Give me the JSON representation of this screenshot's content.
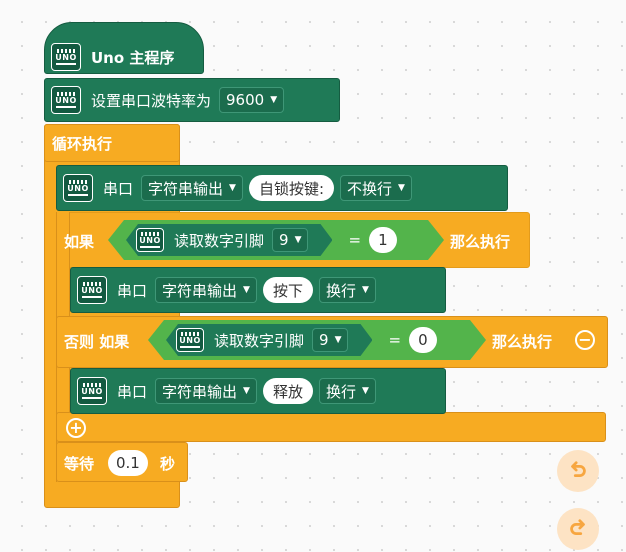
{
  "blocks": {
    "main_hat": {
      "label": "Uno 主程序",
      "icon_text": "UNO"
    },
    "serial_setup": {
      "label": "设置串口波特率为",
      "baud": "9600"
    },
    "loop": {
      "label": "循环执行"
    },
    "print1": {
      "prefix": "串口",
      "mode": "字符串输出",
      "text": "自锁按键:",
      "newline": "不换行"
    },
    "if1": {
      "label": "如果",
      "read_label": "读取数字引脚",
      "pin": "9",
      "op": "=",
      "value": "1",
      "then": "那么执行"
    },
    "print2": {
      "prefix": "串口",
      "mode": "字符串输出",
      "text": "按下",
      "newline": "换行"
    },
    "elseif": {
      "label": "否则 如果",
      "read_label": "读取数字引脚",
      "pin": "9",
      "op": "=",
      "value": "0",
      "then": "那么执行"
    },
    "print3": {
      "prefix": "串口",
      "mode": "字符串输出",
      "text": "释放",
      "newline": "换行"
    },
    "wait": {
      "label": "等待",
      "value": "0.1",
      "unit": "秒"
    }
  },
  "icons": {
    "board": "uno-board-icon",
    "dropdown": "dropdown-arrow-icon",
    "add": "plus-circle-icon",
    "remove": "minus-circle-icon",
    "undo": "undo-icon",
    "redo": "redo-icon"
  },
  "colors": {
    "orange": "#f7ab22",
    "green_dark": "#1f7a57",
    "green_light": "#53b44b",
    "button_bg": "#fde3c4",
    "button_fg": "#f7a640"
  }
}
